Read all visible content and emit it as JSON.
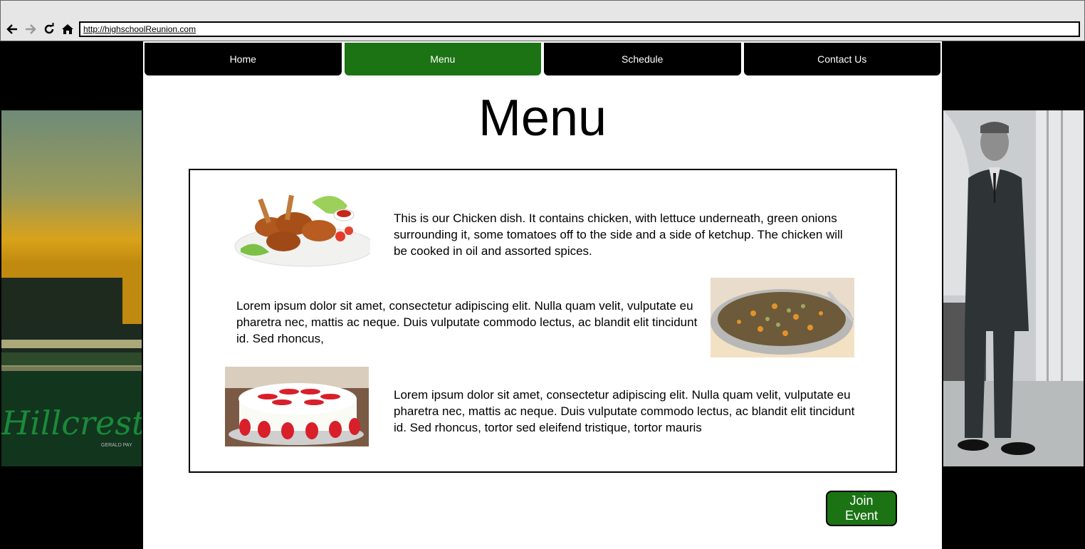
{
  "browser": {
    "url": "http://highschoolReunion.com",
    "icons": [
      "back-arrow-icon",
      "forward-arrow-icon",
      "reload-icon",
      "home-icon"
    ]
  },
  "nav": {
    "tabs": [
      {
        "label": "Home",
        "active": false
      },
      {
        "label": "Menu",
        "active": true
      },
      {
        "label": "Schedule",
        "active": false
      },
      {
        "label": "Contact Us",
        "active": false
      }
    ]
  },
  "page": {
    "title": "Menu",
    "join_button": "Join Event"
  },
  "dishes": [
    {
      "text": "This is our Chicken dish. It contains chicken, with lettuce underneath, green onions surrounding it, some tomatoes off to the side and a side of ketchup. The chicken will be cooked in oil and assorted spices.",
      "image": "chicken-dish-photo"
    },
    {
      "text": "Lorem ipsum dolor sit amet, consectetur adipiscing elit. Nulla quam velit, vulputate eu pharetra nec, mattis ac neque. Duis vulputate commodo lectus, ac blandit elit tincidunt id. Sed rhoncus,",
      "image": "grain-dish-photo"
    },
    {
      "text": "Lorem ipsum dolor sit amet, consectetur adipiscing elit. Nulla quam velit, vulputate eu pharetra nec, mattis ac neque. Duis vulputate commodo lectus, ac blandit elit tincidunt id. Sed rhoncus, tortor sed eleifend tristique, tortor mauris",
      "image": "strawberry-cake-photo"
    }
  ],
  "side_images": {
    "left_caption": "Hillcrest",
    "left_credit": "GERALD PAY"
  },
  "colors": {
    "accent": "#1b7314",
    "tab_bg": "#000000"
  }
}
